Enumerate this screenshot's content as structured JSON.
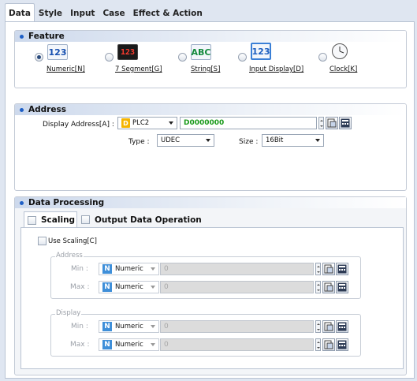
{
  "tabs": [
    {
      "label": "Data"
    },
    {
      "label": "Style"
    },
    {
      "label": "Input"
    },
    {
      "label": "Case"
    },
    {
      "label": "Effect & Action"
    }
  ],
  "feature": {
    "title": "Feature",
    "options": [
      {
        "label": "Numeric[N]",
        "icon": "numeric-123-icon",
        "glyph": "123",
        "selected": true
      },
      {
        "label": "7 Segment[G]",
        "icon": "seven-segment-icon",
        "glyph": "123",
        "selected": false
      },
      {
        "label": "String[S]",
        "icon": "string-abc-icon",
        "glyph": "ABC",
        "selected": false
      },
      {
        "label": "Input Display[D]",
        "icon": "input-display-icon",
        "glyph": "123",
        "selected": false
      },
      {
        "label": "Clock[K]",
        "icon": "clock-icon",
        "glyph": "",
        "selected": false
      }
    ]
  },
  "address": {
    "title": "Address",
    "display_label": "Display Address[A] :",
    "device_badge": "D",
    "device": "PLC2",
    "value": "D0000000",
    "type_label": "Type :",
    "type_value": "UDEC",
    "size_label": "Size :",
    "size_value": "16Bit"
  },
  "processing": {
    "title": "Data Processing",
    "tab_scaling": "Scaling",
    "tab_output": "Output Data Operation",
    "use_scaling": "Use Scaling[C]",
    "address_group": "Address",
    "display_group": "Display",
    "min_label": "Min :",
    "max_label": "Max :",
    "badge": "N",
    "mode": "Numeric",
    "rows": [
      {
        "value": "0"
      },
      {
        "value": "0"
      },
      {
        "value": "0"
      },
      {
        "value": "0"
      }
    ]
  },
  "colors": {
    "accent": "#1e5fc6",
    "device_badge": "#f5b400",
    "address_value": "#1a9a1a"
  }
}
